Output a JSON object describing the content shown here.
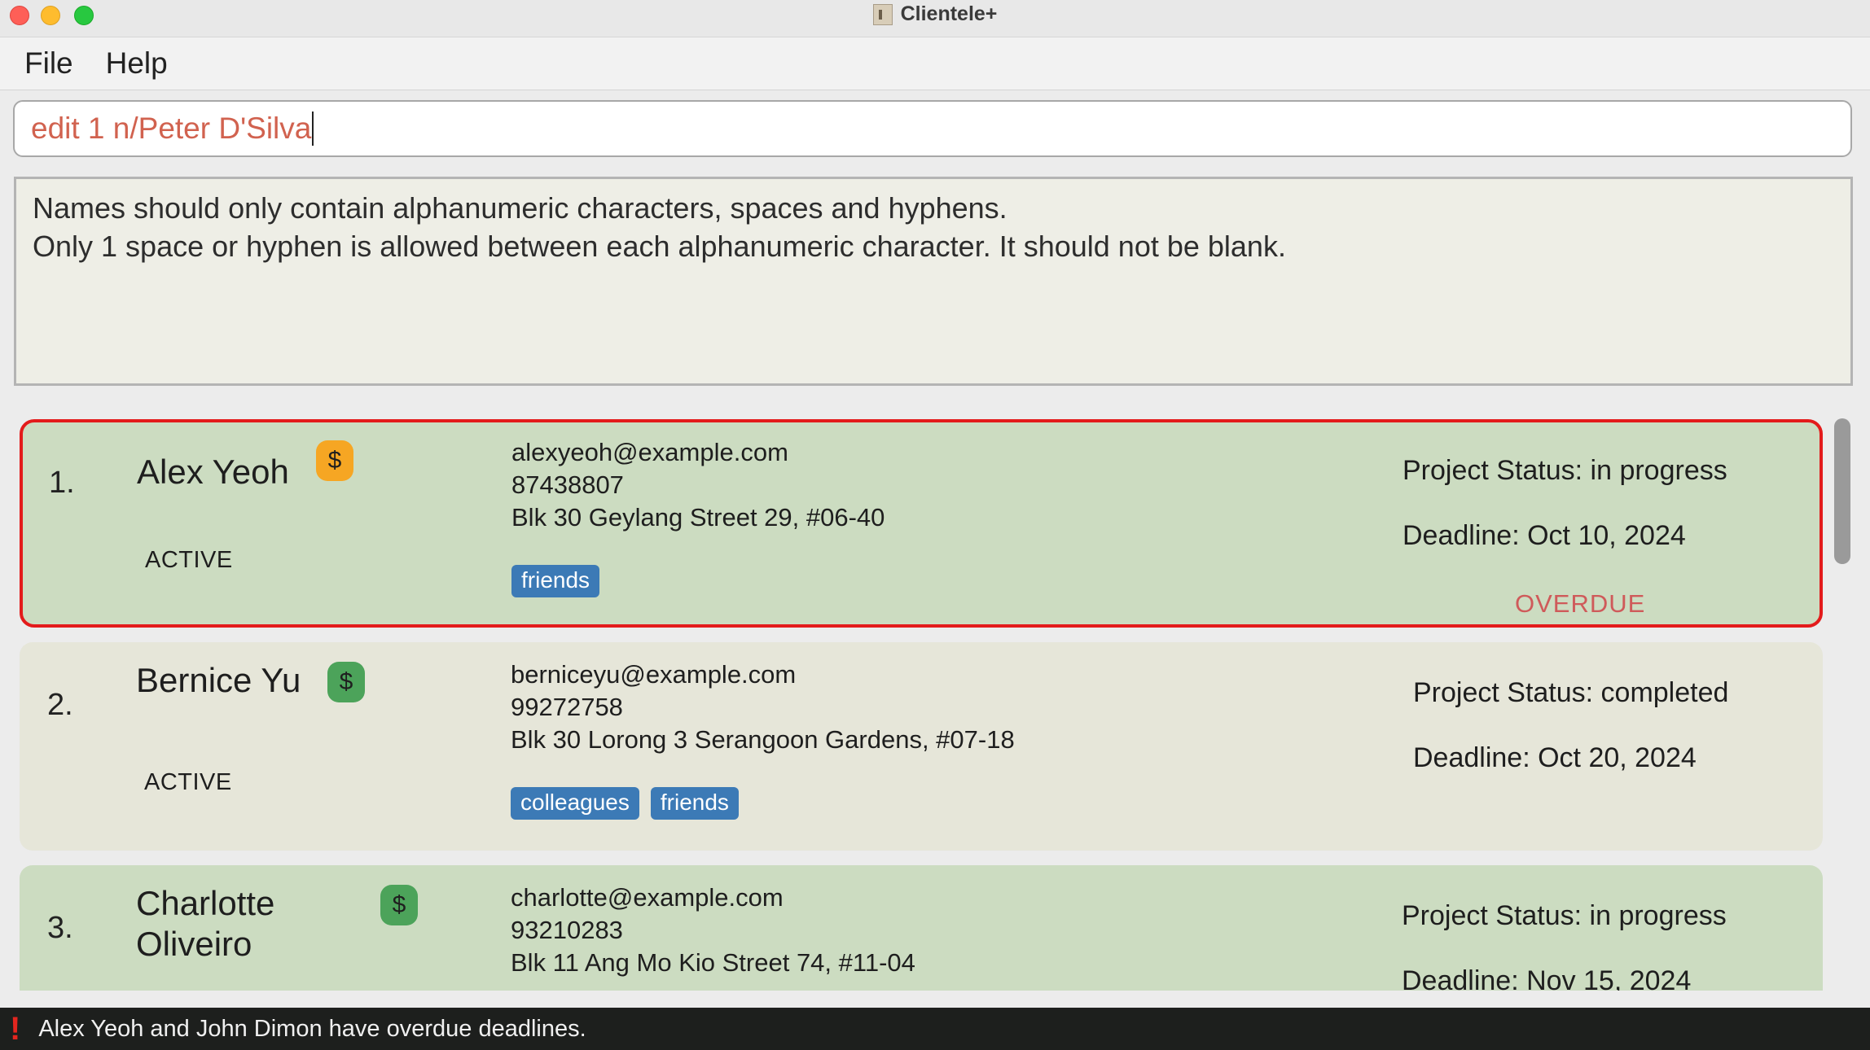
{
  "window": {
    "title": "Clientele+"
  },
  "menu": {
    "items": [
      "File",
      "Help"
    ]
  },
  "command": {
    "value": "edit 1 n/Peter D'Silva"
  },
  "result": {
    "lines": [
      "Names should only contain alphanumeric characters, spaces and hyphens.",
      "Only 1 space or hyphen is allowed between each alphanumeric character. It should not be blank."
    ]
  },
  "clients": [
    {
      "index": "1.",
      "name": "Alex Yeoh",
      "payment_icon": "$",
      "payment_color": "#f6a623",
      "status": "ACTIVE",
      "email": "alexyeoh@example.com",
      "phone": "87438807",
      "address": "Blk 30 Geylang Street 29, #06-40",
      "tags": [
        "friends"
      ],
      "project_status": "Project Status: in progress",
      "deadline": "Deadline: Oct 10, 2024",
      "overdue": "OVERDUE",
      "selected": true
    },
    {
      "index": "2.",
      "name": "Bernice Yu",
      "payment_icon": "$",
      "payment_color": "#4ca35a",
      "status": "ACTIVE",
      "email": "berniceyu@example.com",
      "phone": "99272758",
      "address": "Blk 30 Lorong 3 Serangoon Gardens, #07-18",
      "tags": [
        "colleagues",
        "friends"
      ],
      "project_status": "Project Status: completed",
      "deadline": "Deadline: Oct 20, 2024",
      "overdue": "",
      "selected": false
    },
    {
      "index": "3.",
      "name_lines": [
        "Charlotte",
        "Oliveiro"
      ],
      "payment_icon": "$",
      "payment_color": "#4ca35a",
      "email": "charlotte@example.com",
      "phone": "93210283",
      "address": "Blk 11 Ang Mo Kio Street 74, #11-04",
      "project_status": "Project Status: in progress",
      "deadline": "Deadline: Nov 15, 2024",
      "selected": false
    }
  ],
  "statusbar": {
    "icon": "exclamation-icon",
    "message": "Alex Yeoh and John Dimon have overdue deadlines."
  }
}
